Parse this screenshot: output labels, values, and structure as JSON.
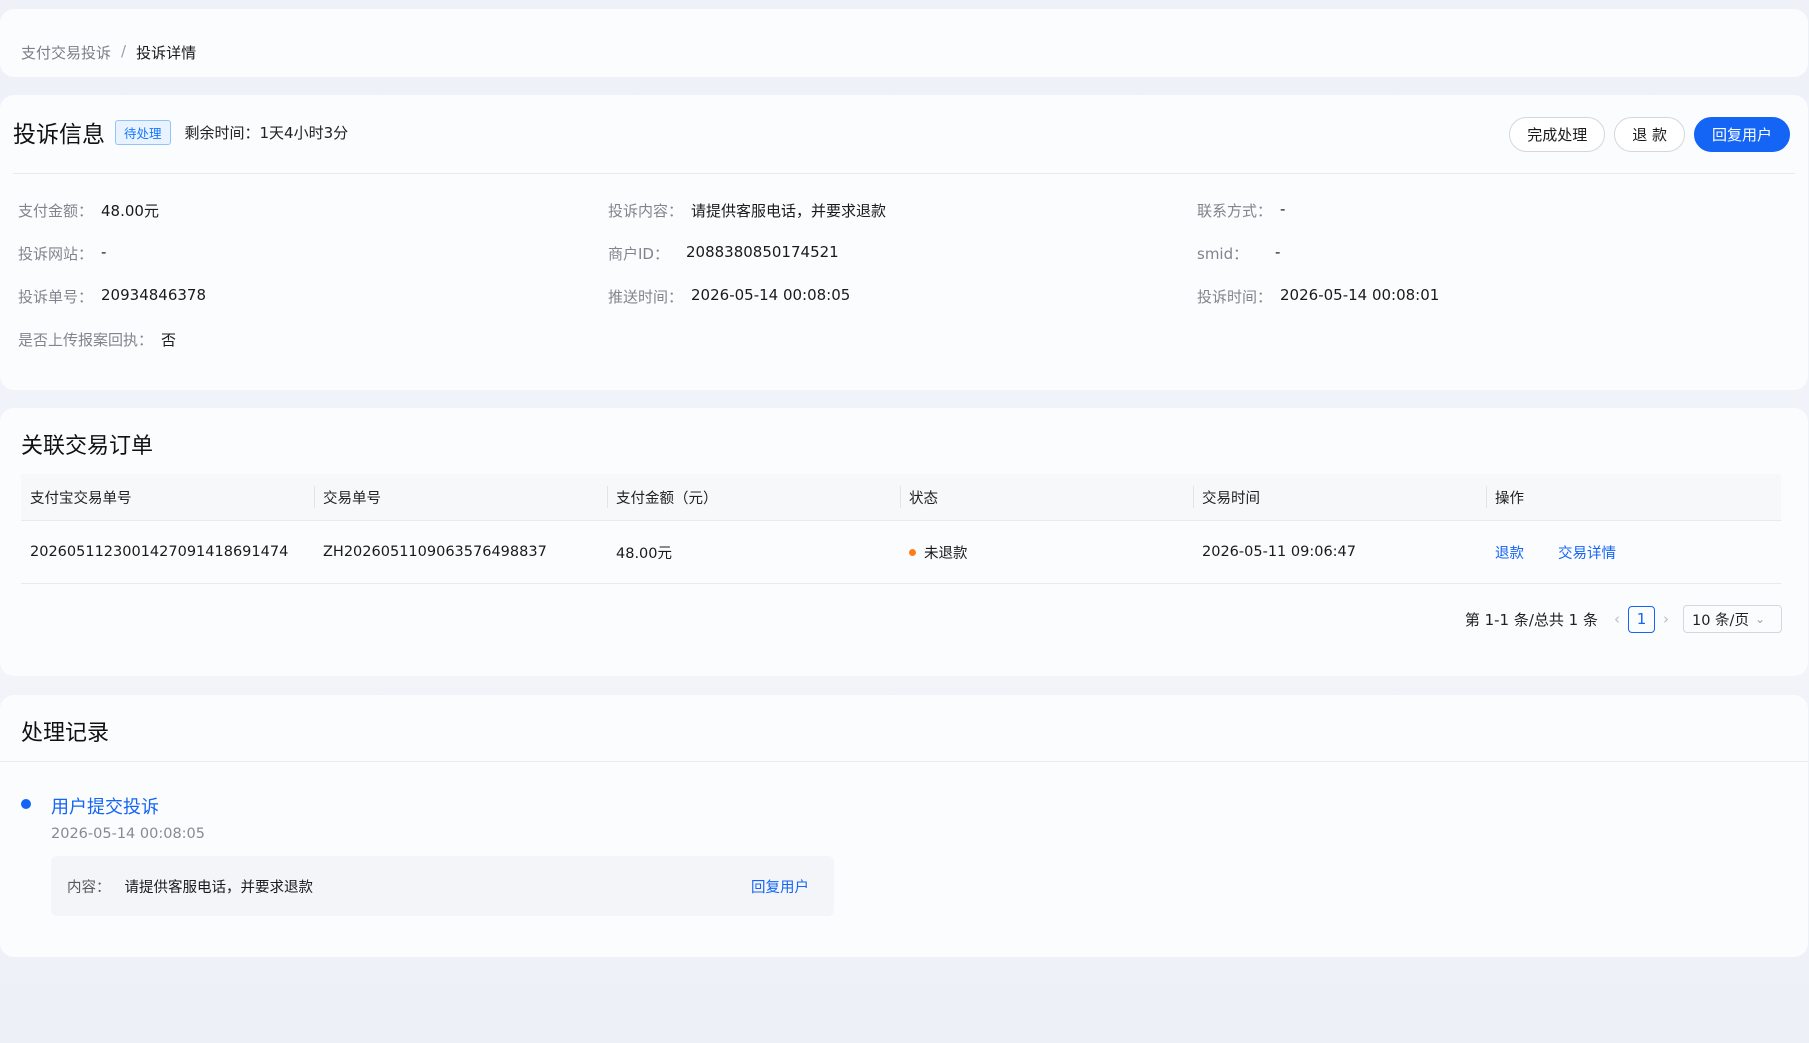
{
  "breadcrumb": {
    "parent": "支付交易投诉",
    "separator": "/",
    "current": "投诉详情"
  },
  "complaint": {
    "title": "投诉信息",
    "status_badge": "待处理",
    "remaining": "剩余时间：1天4小时3分",
    "buttons": {
      "complete": "完成处理",
      "refund": "退 款",
      "reply": "回复用户"
    },
    "fields": {
      "pay_amount": {
        "label": "支付金额：",
        "value": "48.00元"
      },
      "content": {
        "label": "投诉内容：",
        "value": "请提供客服电话，并要求退款"
      },
      "contact": {
        "label": "联系方式：",
        "value": "-"
      },
      "website": {
        "label": "投诉网站：",
        "value": "-"
      },
      "merchant_id": {
        "label": "商户ID：",
        "value": "2088380850174521"
      },
      "smid": {
        "label": "smid：",
        "value": "-"
      },
      "complaint_no": {
        "label": "投诉单号：",
        "value": "20934846378"
      },
      "push_time": {
        "label": "推送时间：",
        "value": "2026-05-14 00:08:05"
      },
      "complaint_time": {
        "label": "投诉时间：",
        "value": "2026-05-14 00:08:01"
      },
      "receipt_uploaded": {
        "label": "是否上传报案回执：",
        "value": "否"
      }
    }
  },
  "orders": {
    "title": "关联交易订单",
    "columns": [
      "支付宝交易单号",
      "交易单号",
      "支付金额（元）",
      "状态",
      "交易时间",
      "操作"
    ],
    "rows": [
      {
        "alipay_no": "2026051123001427091418691474",
        "trade_no": "ZH2026051109063576498837",
        "amount": "48.00元",
        "status": "未退款",
        "time": "2026-05-11 09:06:47",
        "op_refund": "退款",
        "op_detail": "交易详情"
      }
    ],
    "pagination": {
      "summary": "第 1-1 条/总共 1 条",
      "prev": "‹",
      "page": "1",
      "next": "›",
      "page_size": "10 条/页",
      "page_size_chevron": "⌄"
    },
    "status_color": "#ff7d1a"
  },
  "records": {
    "title": "处理记录",
    "items": [
      {
        "title": "用户提交投诉",
        "time": "2026-05-14 00:08:05",
        "content_label": "内容：",
        "content": "请提供客服电话，并要求退款",
        "reply": "回复用户"
      }
    ]
  },
  "colors": {
    "primary": "#1464f6",
    "page_bg": "#eef1f8",
    "card_bg": "#fbfcfe"
  }
}
